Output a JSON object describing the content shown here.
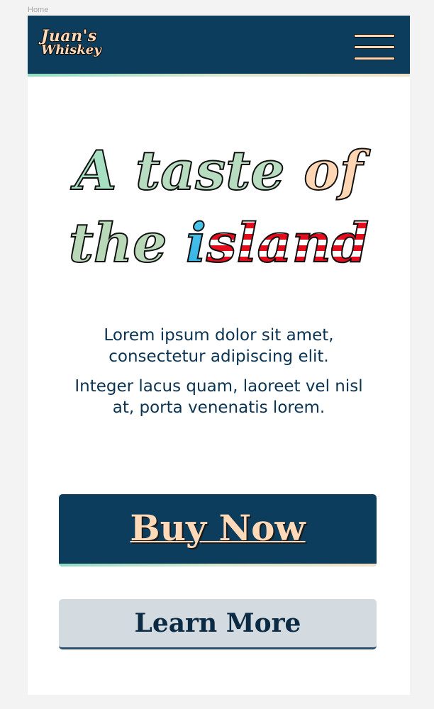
{
  "page": {
    "label": "Home"
  },
  "header": {
    "logo_line1": "Juan's",
    "logo_line2": "Whiskey",
    "menu_icon": "hamburger-menu-icon"
  },
  "hero": {
    "word_a": "A",
    "word_taste": "taste",
    "word_of": "of",
    "word_the": "the",
    "word_island_first": "i",
    "word_island_rest": "sland"
  },
  "content": {
    "paragraph1": "Lorem ipsum dolor sit amet, consectetur adipiscing elit.",
    "paragraph2": "Integer lacus quam, laoreet vel nisl at, porta venenatis lorem."
  },
  "actions": {
    "buy_label": "Buy Now",
    "learn_label": "Learn More"
  },
  "colors": {
    "navy": "#0d3d5c",
    "peach": "#ffd9b8",
    "mint": "#a6dfc2",
    "flag_red": "#e30d1d",
    "flag_blue": "#34b2e6",
    "secondary_button": "#d3dbe0"
  }
}
